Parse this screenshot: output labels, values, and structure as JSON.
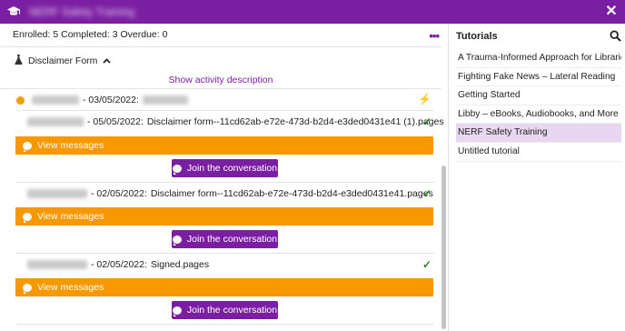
{
  "window": {
    "title": "NERF Safety Training",
    "close_label": "✕"
  },
  "stats": {
    "text": "Enrolled: 5  Completed: 3  Overdue: 0"
  },
  "form": {
    "title": "Disclaimer Form",
    "show_description": "Show activity description"
  },
  "submissions": [
    {
      "date": "- 03/05/2022:",
      "detail": ""
    },
    {
      "date": "- 05/05/2022:",
      "detail": "Disclaimer form--11cd62ab-e72e-473d-b2d4-e3ded0431e41 (1).pages"
    },
    {
      "date": "- 02/05/2022:",
      "detail": "Disclaimer form--11cd62ab-e72e-473d-b2d4-e3ded0431e41.pages"
    },
    {
      "date": "- 02/05/2022:",
      "detail": "Signed.pages"
    }
  ],
  "buttons": {
    "view_messages": "View messages",
    "join_conversation": "Join the conversation"
  },
  "sidebar": {
    "title": "Tutorials",
    "items": [
      "A Trauma-Informed Approach for Libraries",
      "Fighting Fake News – Lateral Reading",
      "Getting Started",
      "Libby – eBooks, Audiobooks, and More",
      "NERF Safety Training",
      "Untitled tutorial"
    ],
    "active_index": 4
  },
  "colors": {
    "brand_purple": "#7b1fa2",
    "accent_orange": "#f79800",
    "success_green": "#2e7d32",
    "active_item_bg": "#e9d6f1"
  }
}
